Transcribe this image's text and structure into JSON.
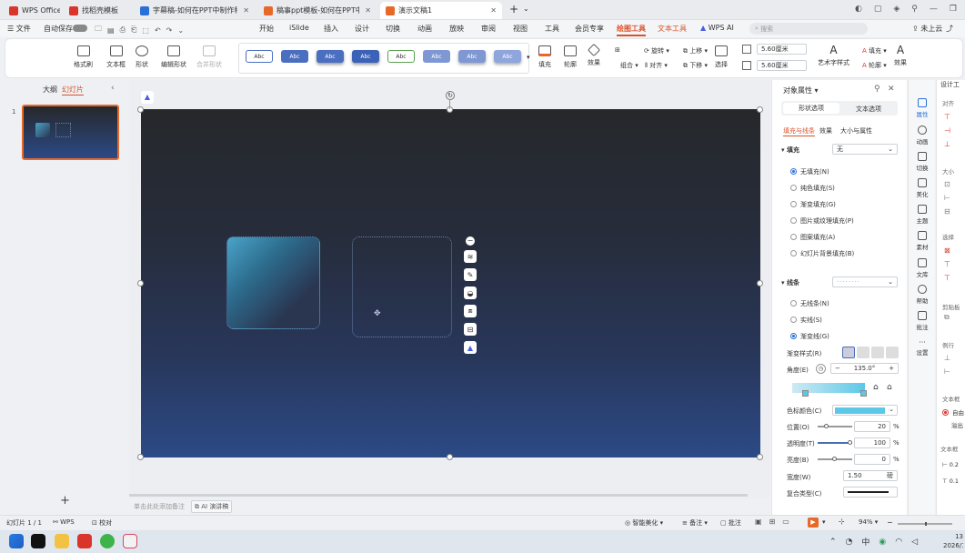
{
  "titlebar": {
    "tabs": [
      {
        "label": "WPS Office",
        "color": "#d9352b"
      },
      {
        "label": "找稻壳模板",
        "color": "#d9352b"
      },
      {
        "label": "字幕稿-如何在PPT中制作科技感光效",
        "color": "#2b6fd9"
      },
      {
        "label": "稿事ppt模板-如何在PPT中制作",
        "color": "#e8682a"
      },
      {
        "label": "演示文稿1",
        "color": "#e8682a"
      }
    ],
    "new_tab": "+"
  },
  "menubar": {
    "file": "文件",
    "autosave": "自动保存",
    "items": [
      "开始",
      "iSlide",
      "插入",
      "设计",
      "切换",
      "动画",
      "放映",
      "审阅",
      "视图",
      "工具",
      "会员专享",
      "绘图工具",
      "文本工具"
    ],
    "active": "绘图工具",
    "wps_ai": "WPS AI",
    "search_placeholder": "搜索",
    "cloud": "未上云"
  },
  "ribbon": {
    "format_painter": "格式刷",
    "textbox": "文本框",
    "shape": "形状",
    "edit_shape": "编辑形状",
    "merge_shape": "合并形状",
    "style_label": "Abc",
    "fill": "填充",
    "outline": "轮廓",
    "effect": "效果",
    "rotate": "旋转",
    "combine": "组合",
    "align": "对齐",
    "up": "上移",
    "down": "下移",
    "select": "选择",
    "width": "5.60厘米",
    "height": "5.60厘米",
    "art_text": "艺术字样式",
    "text_fill": "填充",
    "text_outline": "轮廓",
    "text_effect": "效果"
  },
  "leftpanel": {
    "outline_tab": "大纲",
    "slides_tab": "幻灯片",
    "slide_number": "1",
    "add": "+"
  },
  "canvas": {
    "notes_placeholder": "单击此处添加备注",
    "ai_notes": "AI 演讲稿"
  },
  "rightpanel": {
    "title": "对象属性",
    "tab_shape": "形状选项",
    "tab_text": "文本选项",
    "sub_fill_line": "填充与线条",
    "sub_effect": "效果",
    "sub_size": "大小与属性",
    "fill_heading": "填充",
    "fill_value": "无",
    "fill_options": [
      "无填充(N)",
      "纯色填充(S)",
      "渐变填充(G)",
      "图片或纹理填充(P)",
      "图案填充(A)",
      "幻灯片背景填充(B)"
    ],
    "line_heading": "线条",
    "line_options": [
      "无线条(N)",
      "实线(S)",
      "渐变线(G)"
    ],
    "gradient_style": "渐变样式(R)",
    "angle_label": "角度(E)",
    "angle_value": "135.0°",
    "color_label": "色标颜色(C)",
    "gradient_color": "#5cc8e8",
    "position_label": "位置(O)",
    "position_value": "20",
    "transparency_label": "透明度(T)",
    "transparency_value": "100",
    "brightness_label": "亮度(B)",
    "brightness_value": "0",
    "width_label": "宽度(W)",
    "width_value": "1.50",
    "width_unit": "磅",
    "compound_label": "复合类型(C)",
    "percent": "%"
  },
  "iconstrip": [
    "属性",
    "动画",
    "切换",
    "美化",
    "主题",
    "素材",
    "文库",
    "帮助",
    "批注",
    "设置"
  ],
  "farright": {
    "labels": [
      "设计工",
      "对齐",
      "大小",
      "选择",
      "剪贴板",
      "例行",
      "文本框",
      "自由",
      "溢出",
      "文本框",
      "0.2",
      "0.1"
    ]
  },
  "statusbar": {
    "slide_info": "幻灯片 1 / 1",
    "wps": "WPS",
    "proof": "校对",
    "beautify": "智能美化",
    "notes": "备注",
    "comments": "批注",
    "zoom": "94%"
  },
  "taskbar": {
    "time": "13",
    "date": "2026/1"
  }
}
